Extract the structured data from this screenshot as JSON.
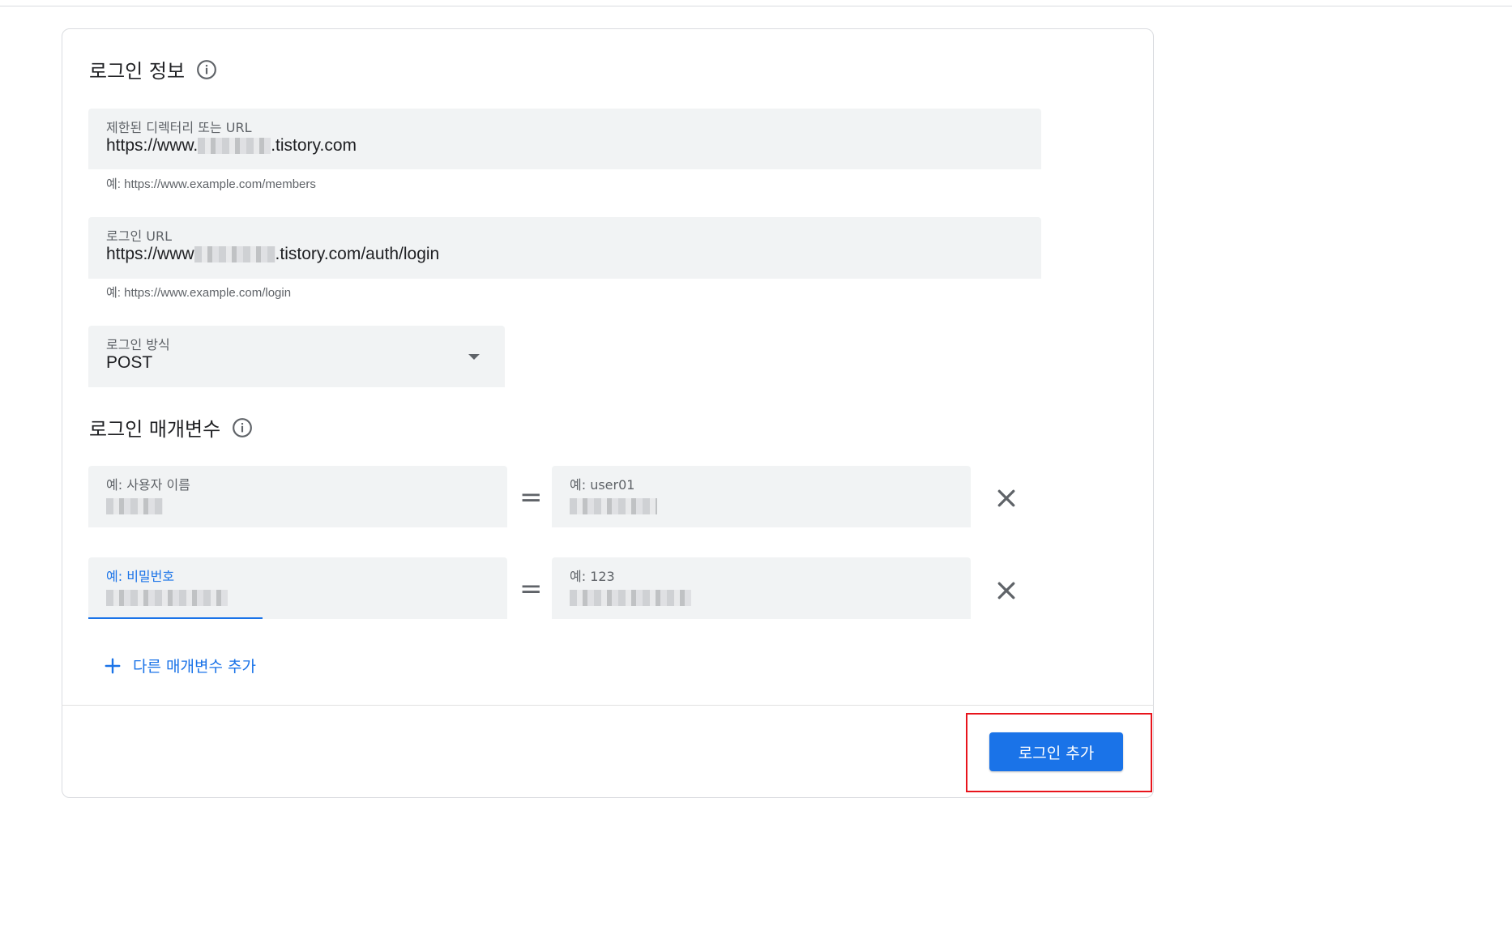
{
  "login_info": {
    "title": "로그인 정보",
    "restricted_url": {
      "label": "제한된 디렉터리 또는 URL",
      "value_prefix": "https://www.",
      "value_suffix": ".tistory.com",
      "hint": "예: https://www.example.com/members"
    },
    "login_url": {
      "label": "로그인 URL",
      "value_prefix": "https://www",
      "value_suffix": ".tistory.com/auth/login",
      "hint": "예: https://www.example.com/login"
    },
    "login_method": {
      "label": "로그인 방식",
      "value": "POST"
    }
  },
  "login_params": {
    "title": "로그인 매개변수",
    "rows": [
      {
        "name_placeholder": "예: 사용자 이름",
        "value_placeholder": "예: user01",
        "equals": "=",
        "focused": false
      },
      {
        "name_placeholder": "예: 비밀번호",
        "value_placeholder": "예: 123",
        "equals": "=",
        "focused": true
      }
    ],
    "add_label": "다른 매개변수 추가"
  },
  "footer": {
    "submit_label": "로그인 추가"
  },
  "colors": {
    "primary": "#1a73e8",
    "highlight": "#e8141c",
    "field_bg": "#f1f3f4"
  },
  "icons": {
    "info": "info-icon",
    "dropdown": "dropdown-arrow-icon",
    "remove": "close-icon",
    "add": "plus-icon"
  }
}
